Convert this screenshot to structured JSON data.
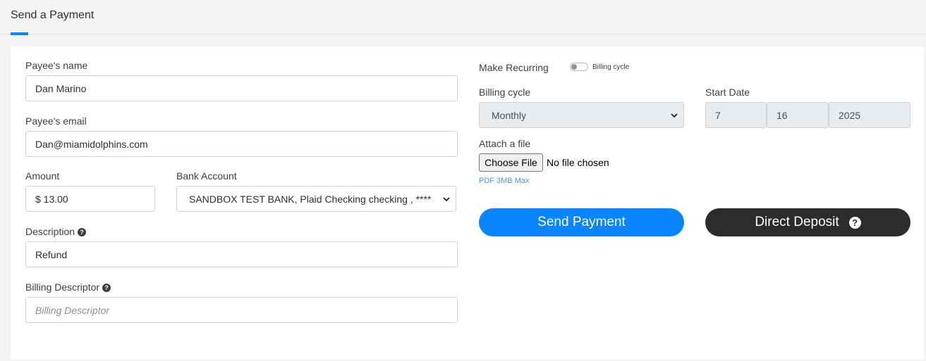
{
  "header": {
    "title": "Send a Payment"
  },
  "form": {
    "payee_name": {
      "label": "Payee's name",
      "value": "Dan Marino"
    },
    "payee_email": {
      "label": "Payee's email",
      "value": "Dan@miamidolphins.com"
    },
    "amount": {
      "label": "Amount",
      "value": "$ 13.00"
    },
    "bank_account": {
      "label": "Bank Account",
      "value": "SANDBOX TEST BANK, Plaid Checking checking , ****"
    },
    "description": {
      "label": "Description",
      "value": "Refund"
    },
    "billing_descriptor": {
      "label": "Billing Descriptor",
      "value": "",
      "placeholder": "Billing Descriptor"
    }
  },
  "recurring": {
    "label": "Make Recurring",
    "toggle_label": "Billing cycle",
    "toggle_on": false,
    "billing_cycle": {
      "label": "Billing cycle",
      "value": "Monthly"
    },
    "start_date": {
      "label": "Start Date",
      "month": "7",
      "day": "16",
      "year": "2025"
    }
  },
  "attachment": {
    "label": "Attach a file",
    "button_label": "Choose File",
    "status": "No file chosen",
    "hint": "PDF 3MB Max"
  },
  "actions": {
    "send_label": "Send Payment",
    "direct_deposit_label": "Direct Deposit"
  },
  "colors": {
    "primary": "#0a84ff",
    "dark": "#2b2c2e",
    "hint": "#3d9ae8"
  },
  "icons": {
    "help": "question-circle-icon",
    "select": "chevron-down-icon"
  }
}
